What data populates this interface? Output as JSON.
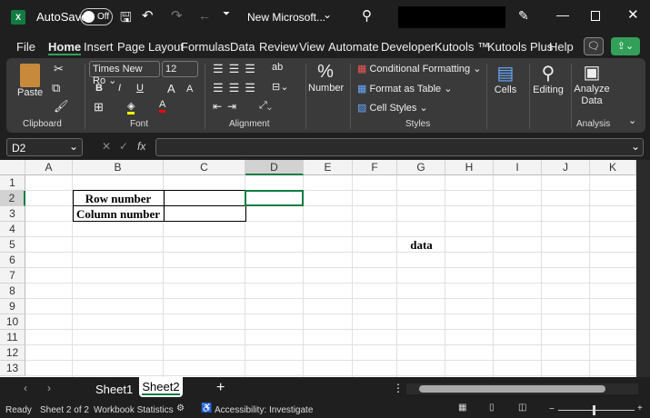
{
  "title": {
    "app_icon": "excel-icon",
    "autosave": "AutoSave",
    "toggle": "Off",
    "doc": "New Microsoft...",
    "chevron": "⌄"
  },
  "menu": [
    "File",
    "Home",
    "Insert",
    "Page Layout",
    "Formulas",
    "Data",
    "Review",
    "View",
    "Automate",
    "Developer",
    "Kutools ™",
    "Kutools Plus",
    "Help"
  ],
  "ribbon": {
    "paste": "Paste",
    "font_name": "Times New Ro",
    "font_size": "12",
    "bold": "B",
    "italic": "I",
    "underline": "U",
    "grow": "A",
    "shrink": "A",
    "font_color": "A",
    "number": "Number",
    "cond_format": "Conditional Formatting",
    "format_table": "Format as Table",
    "cell_styles": "Cell Styles",
    "cells": "Cells",
    "editing": "Editing",
    "analyze1": "Analyze",
    "analyze2": "Data",
    "groups": {
      "clipboard": "Clipboard",
      "font": "Font",
      "alignment": "Alignment",
      "styles": "Styles",
      "analysis": "Analysis"
    },
    "colors": {
      "highlight": "#ffff00",
      "font": "#ff0000",
      "accent": "#33a05a"
    }
  },
  "formula": {
    "name_box": "D2",
    "fx": "fx",
    "value": ""
  },
  "columns": [
    "A",
    "B",
    "C",
    "D",
    "E",
    "F",
    "G",
    "H",
    "I",
    "J",
    "K"
  ],
  "rows": [
    "1",
    "2",
    "3",
    "4",
    "5",
    "6",
    "7",
    "8",
    "9",
    "10",
    "11",
    "12",
    "13"
  ],
  "cells": {
    "B2": "Row number",
    "B3": "Column number",
    "G5": "data"
  },
  "selected": "D2",
  "sheets": [
    "Sheet1",
    "Sheet2"
  ],
  "active_sheet": "Sheet2",
  "add": "+",
  "status": {
    "ready": "Ready",
    "sheet": "Sheet 2 of 2",
    "stats": "Workbook Statistics",
    "access": "Accessibility: Investigate",
    "minus": "−",
    "plus": "+"
  }
}
